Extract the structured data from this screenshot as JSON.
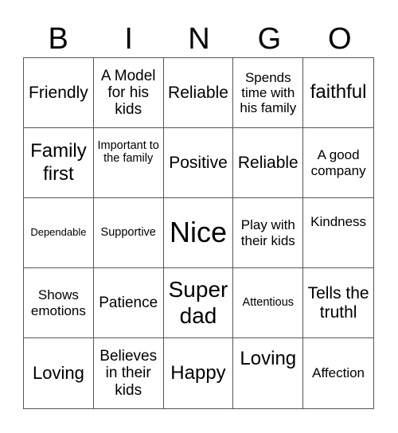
{
  "header": [
    "B",
    "I",
    "N",
    "G",
    "O"
  ],
  "cells": [
    "Friendly",
    "A Model for his kids",
    "Reliable",
    "Spends time with his family",
    "faithful",
    "Family first",
    "Important to the family",
    "Positive",
    "Reliable",
    "A good company",
    "Dependable",
    "Supportive",
    "Nice",
    "Play with their kids",
    "Kindness",
    "Shows emotions",
    "Patience",
    "Super dad",
    "Attentious",
    "Tells the truthl",
    "Loving",
    "Believes in their kids",
    "Happy",
    "Loving",
    "Affection"
  ]
}
